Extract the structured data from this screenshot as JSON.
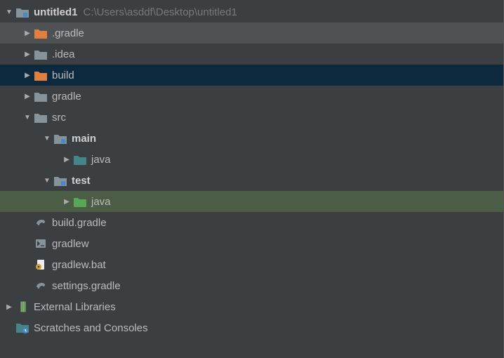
{
  "tree": {
    "root": {
      "name": "untitled1",
      "path": "C:\\Users\\asddf\\Desktop\\untitled1",
      "items": {
        "gradle_dir": ".gradle",
        "idea_dir": ".idea",
        "build": "build",
        "gradle": "gradle",
        "src": {
          "name": "src",
          "main": {
            "name": "main",
            "java": "java"
          },
          "test": {
            "name": "test",
            "java": "java"
          }
        },
        "build_gradle": "build.gradle",
        "gradlew": "gradlew",
        "gradlew_bat": "gradlew.bat",
        "settings_gradle": "settings.gradle"
      }
    },
    "external_libraries": "External Libraries",
    "scratches": "Scratches and Consoles"
  }
}
